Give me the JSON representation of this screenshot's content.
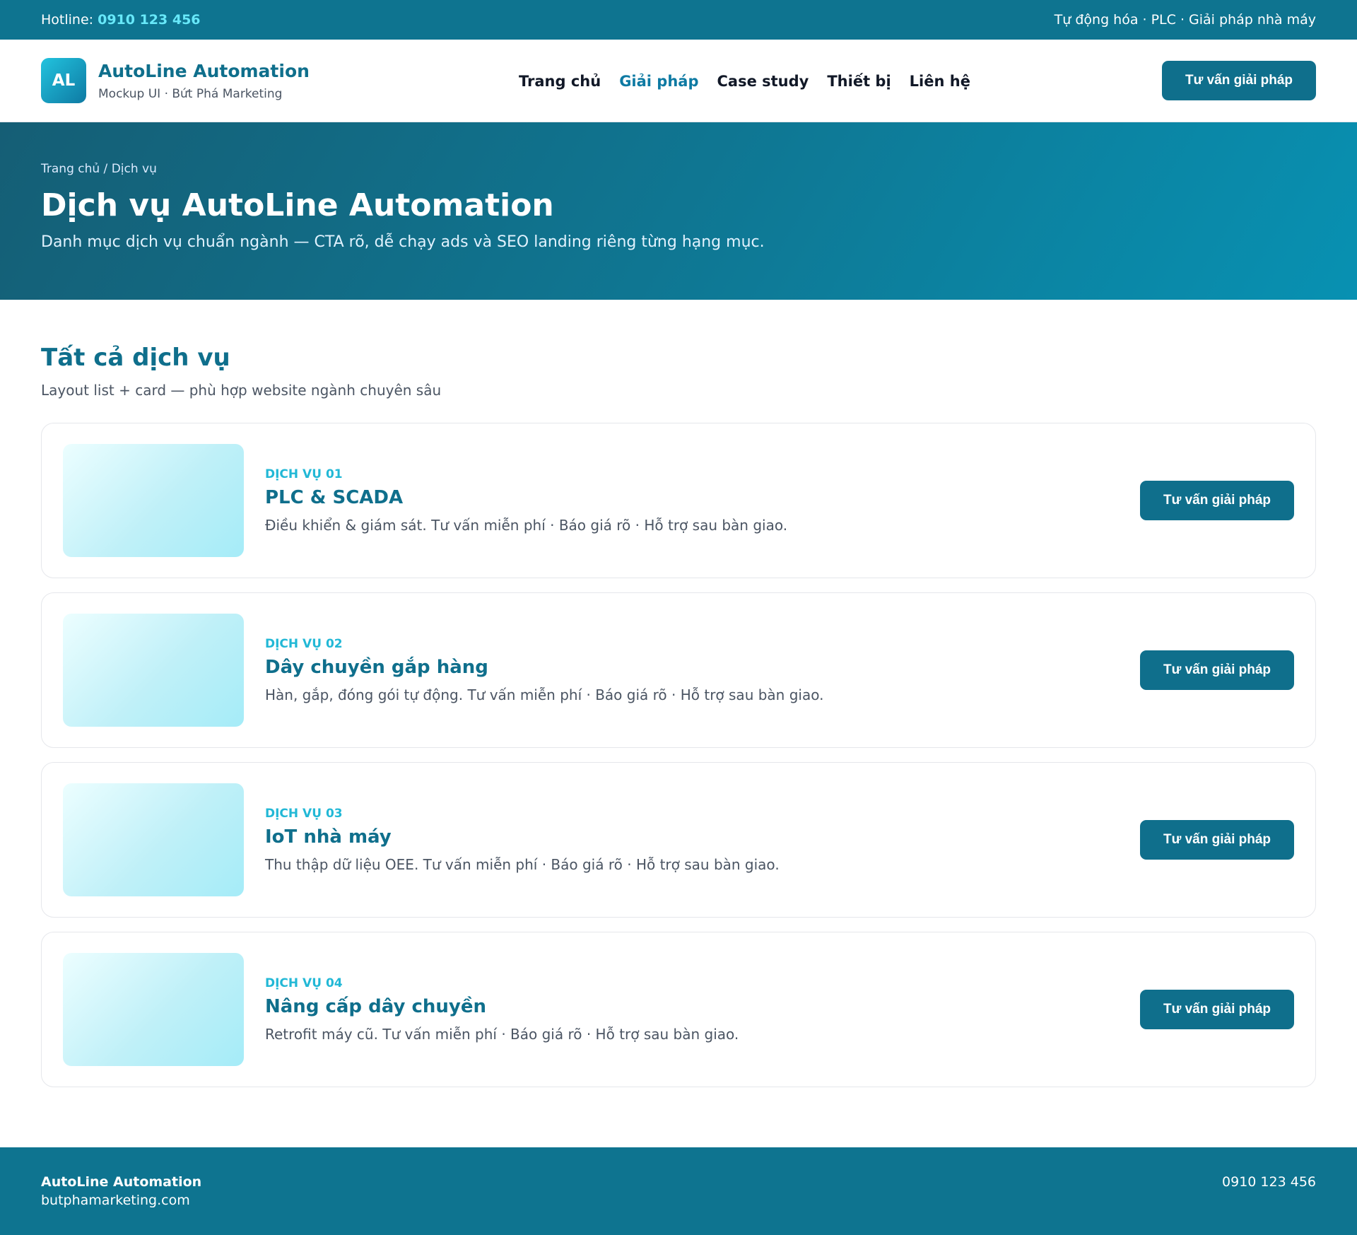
{
  "topbar": {
    "hotline_label": "Hotline: ",
    "hotline_number": "0910 123 456",
    "tagline": "Tự động hóa · PLC · Giải pháp nhà máy"
  },
  "brand": {
    "logo_text": "AL",
    "name": "AutoLine Automation",
    "subtitle": "Mockup UI · Bứt Phá Marketing"
  },
  "nav": {
    "items": [
      {
        "label": "Trang chủ"
      },
      {
        "label": "Giải pháp"
      },
      {
        "label": "Case study"
      },
      {
        "label": "Thiết bị"
      },
      {
        "label": "Liên hệ"
      }
    ],
    "active_index": 1,
    "cta_label": "Tư vấn giải pháp"
  },
  "hero": {
    "breadcrumb": "Trang chủ / Dịch vụ",
    "title": "Dịch vụ AutoLine Automation",
    "description": "Danh mục dịch vụ chuẩn ngành — CTA rõ, dễ chạy ads và SEO landing riêng từng hạng mục."
  },
  "section": {
    "title": "Tất cả dịch vụ",
    "subtitle": "Layout list + card — phù hợp website ngành chuyên sâu"
  },
  "services": [
    {
      "tag": "DỊCH VỤ 01",
      "title": "PLC & SCADA",
      "description": "Điều khiển & giám sát. Tư vấn miễn phí · Báo giá rõ · Hỗ trợ sau bàn giao.",
      "cta": "Tư vấn giải pháp"
    },
    {
      "tag": "DỊCH VỤ 02",
      "title": "Dây chuyền gắp hàng",
      "description": "Hàn, gắp, đóng gói tự động. Tư vấn miễn phí · Báo giá rõ · Hỗ trợ sau bàn giao.",
      "cta": "Tư vấn giải pháp"
    },
    {
      "tag": "DỊCH VỤ 03",
      "title": "IoT nhà máy",
      "description": "Thu thập dữ liệu OEE. Tư vấn miễn phí · Báo giá rõ · Hỗ trợ sau bàn giao.",
      "cta": "Tư vấn giải pháp"
    },
    {
      "tag": "DỊCH VỤ 04",
      "title": "Nâng cấp dây chuyền",
      "description": "Retrofit máy cũ. Tư vấn miễn phí · Báo giá rõ · Hỗ trợ sau bàn giao.",
      "cta": "Tư vấn giải pháp"
    }
  ],
  "footer": {
    "company": "AutoLine Automation",
    "website": "butphamarketing.com",
    "phone": "0910 123 456"
  }
}
